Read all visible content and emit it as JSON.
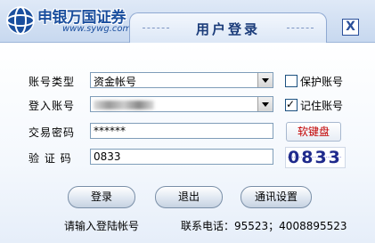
{
  "title_bar": {
    "brand": "申银万国证券",
    "url": "www.sywg.com",
    "title": "用户登录",
    "close_glyph": "X"
  },
  "form": {
    "account_type": {
      "label": "账号类型",
      "value": "资金帐号",
      "protect_label": "保护账号",
      "protect_checked": false
    },
    "login_account": {
      "label": "登入账号",
      "value": "",
      "remember_label": "记住账号",
      "remember_checked": true,
      "remember_glyph": "✓"
    },
    "trade_password": {
      "label": "交易密码",
      "value": "******",
      "keyboard_button": "软键盘"
    },
    "verify_code": {
      "label": "验 证 码",
      "value": "0833",
      "captcha_text": "0833"
    }
  },
  "buttons": {
    "login": "登录",
    "exit": "退出",
    "comm_settings": "通讯设置"
  },
  "footer": {
    "hint": "请输入登陆帐号",
    "phone": "联系电话：95523；4008895523"
  },
  "colors": {
    "brand_blue": "#1b4f9e",
    "keyboard_red": "#c20000",
    "captcha_blue": "#1f2a8c"
  },
  "icons": {
    "logo": "globe-logo-icon",
    "dropdown": "chevron-down-icon",
    "close": "close-icon"
  }
}
